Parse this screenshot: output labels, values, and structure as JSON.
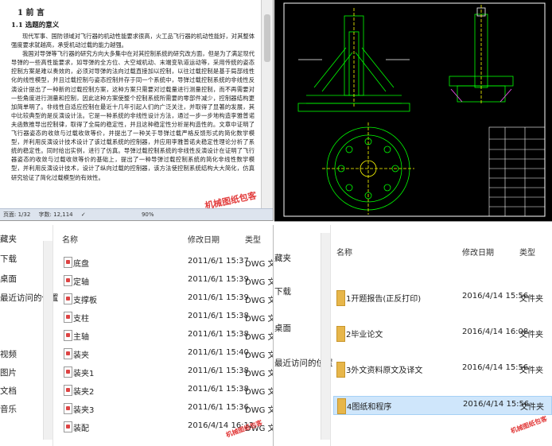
{
  "word_doc": {
    "chapter_heading": "1  前  言",
    "section_heading": "1.1 选题的意义",
    "paragraphs": [
      "现代军事、国防领域对飞行器的机动性能要求很高，火工品飞行器的机动性能好，对其整体强度要求就越高，承受机动过载的能力越强。",
      "我国对导弹等飞行器的研究方向大多集中在对其控制系统的研究改方面，但是为了满足现代导弹的一些高性能要求，如导弹的全方位、大空域机动、末端变轨道运动等，采用传统的姿态控制方案是难以奏效的，必须对导弹的法向过载直接加以控制，以往过载控制是基于局部线性化的线性模型，并且过载控制与姿态控制并存于同一个系统中，导弹过载控制系统的非线性反演设计提出了一种新的过载控制方案，这种方案只需要对过载量进行测量控制，而不再需要对一些角度进行测量和控制，因此这种方案使整个控制系统所需要的零部件减少，控制器结构更加简单明了。非线性自适应控制在最近十几年引起人们的广泛关注，并取得了显著的发展，其中比较典型的是反演设计法。它是一种系统的非线性设计方法，通过一步一步地构造李雅普诺夫函数推导出控制律，取得了全局的稳定性，并且这种稳定性分析是构造性的。文章中证明了飞行器姿态的收敛与过载收敛等价，并提出了一种关于导弹过载严格反馈形式的简化数学模型，并利用反演设计技术设计了该过载系统的控制器，并应用李雅普诺夫稳定性理论分析了系统的稳定性。同时给出实例，进行了仿真。导弹过载控制系统的非线性反演设计在证明了飞行器姿态的收敛与过载收敛等价的基础上，提出了一种导弹过载控制系统的简化非线性数学模型，并利用反演设计技术，设计了纵向过载的控制器，该方法使控制系统结构大大简化，仿真研究验证了简化过载模型的有效性。"
    ],
    "statusbar": {
      "page": "页面: 1/32",
      "words": "字数: 12,114",
      "zoom": "90%"
    },
    "watermark": "机械图纸包客"
  },
  "explorer_files": {
    "nav_items": [
      "藏夹",
      "下载",
      "桌面",
      "最近访问的位置",
      "视频",
      "图片",
      "文档",
      "音乐"
    ],
    "columns": {
      "name": "名称",
      "date": "修改日期",
      "type": "类型"
    },
    "rows": [
      {
        "name": "底盘",
        "date": "2011/6/1 15:37",
        "type": "DWG 文"
      },
      {
        "name": "定轴",
        "date": "2011/6/1 15:39",
        "type": "DWG 文"
      },
      {
        "name": "支撑板",
        "date": "2011/6/1 15:39",
        "type": "DWG 文"
      },
      {
        "name": "支柱",
        "date": "2011/6/1 15:38",
        "type": "DWG 文"
      },
      {
        "name": "主轴",
        "date": "2011/6/1 15:38",
        "type": "DWG 文"
      },
      {
        "name": "装夹",
        "date": "2011/6/1 15:40",
        "type": "DWG 文"
      },
      {
        "name": "装夹1",
        "date": "2011/6/1 15:38",
        "type": "DWG 文"
      },
      {
        "name": "装夹2",
        "date": "2011/6/1 15:38",
        "type": "DWG 文"
      },
      {
        "name": "装夹3",
        "date": "2011/6/1 15:36",
        "type": "DWG 文"
      },
      {
        "name": "装配",
        "date": "2016/4/14 16:12",
        "type": "DWG 文"
      }
    ],
    "watermark": "机械图纸包客"
  },
  "explorer_folders": {
    "nav_items": [
      "藏夹",
      "下载",
      "桌面",
      "最近访问的位置"
    ],
    "columns": {
      "name": "名称",
      "date": "修改日期",
      "type": "类型"
    },
    "rows": [
      {
        "name": "1开题报告(正反打印)",
        "date": "2016/4/14 15:56",
        "type": "文件夹"
      },
      {
        "name": "2毕业论文",
        "date": "2016/4/14 16:08",
        "type": "文件夹"
      },
      {
        "name": "3外文资料原文及译文",
        "date": "2016/4/14 15:56",
        "type": "文件夹"
      },
      {
        "name": "4图纸和程序",
        "date": "2016/4/14 15:56",
        "type": "文件夹"
      }
    ],
    "watermark": "机械图纸包客"
  },
  "colors": {
    "cad_bg": "#000000",
    "cad_green": "#00ff00",
    "cad_yellow": "#ffff00",
    "cad_white": "#ffffff",
    "folder": "#e7b64a",
    "selection": "#cfe6fb",
    "watermark": "#e23c3c"
  }
}
